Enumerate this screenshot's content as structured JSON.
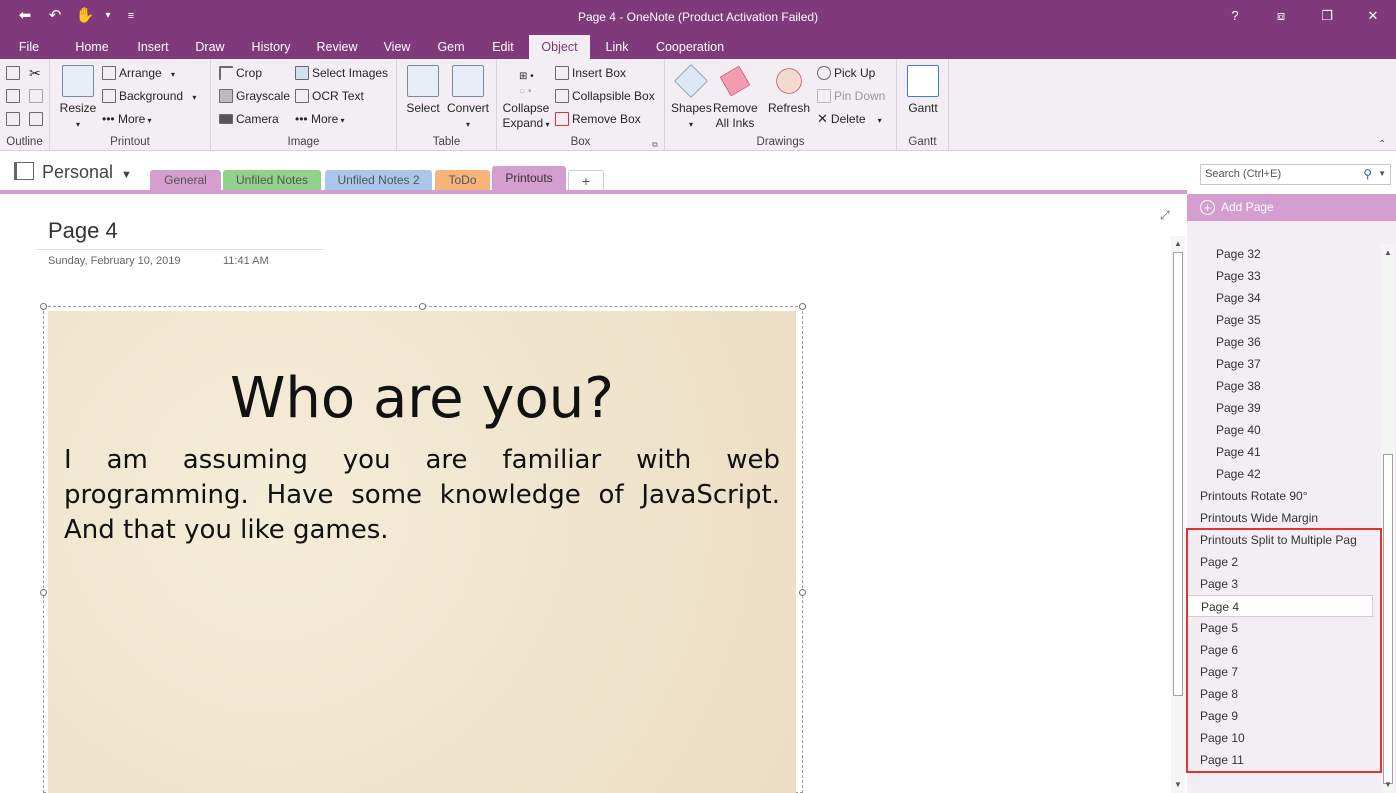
{
  "window": {
    "title": "Page 4 - OneNote (Product Activation Failed)",
    "controls": [
      "?",
      "⧈",
      "❐",
      "✕"
    ]
  },
  "qat": [
    "⬅",
    "↶",
    "✋",
    "▾",
    "≡"
  ],
  "ribbon_tabs": [
    "File",
    "Home",
    "Insert",
    "Draw",
    "History",
    "Review",
    "View",
    "Gem",
    "Edit",
    "Object",
    "Link",
    "Cooperation"
  ],
  "active_tab": "Object",
  "groups": {
    "outline": "Outline",
    "printout": {
      "label": "Printout",
      "resize": "Resize",
      "arrange": "Arrange",
      "background": "Background",
      "more": "More"
    },
    "image": {
      "label": "Image",
      "crop": "Crop",
      "grayscale": "Grayscale",
      "camera": "Camera",
      "select_images": "Select Images",
      "ocr_text": "OCR Text",
      "more": "More"
    },
    "table": {
      "label": "Table",
      "select": "Select",
      "convert": "Convert"
    },
    "box": {
      "label": "Box",
      "collapse": "Collapse",
      "expand": "Expand",
      "insert_box": "Insert Box",
      "collapsible_box": "Collapsible Box",
      "remove_box": "Remove Box"
    },
    "drawings": {
      "label": "Drawings",
      "shapes": "Shapes",
      "remove": "Remove",
      "all_inks": "All Inks",
      "refresh": "Refresh",
      "pick_up": "Pick Up",
      "pin_down": "Pin Down",
      "delete": "Delete"
    },
    "gantt": {
      "label": "Gantt",
      "gantt": "Gantt"
    }
  },
  "notebook": {
    "name": "Personal"
  },
  "sections": [
    {
      "label": "General",
      "color": "#d49ed1"
    },
    {
      "label": "Unfiled Notes",
      "color": "#92d18b"
    },
    {
      "label": "Unfiled Notes 2",
      "color": "#a9c7ea"
    },
    {
      "label": "ToDo",
      "color": "#f5b47a"
    },
    {
      "label": "Printouts",
      "color": "#d49ed1"
    },
    {
      "label": "+",
      "color": "#ffffff"
    }
  ],
  "search": {
    "placeholder": "Search (Ctrl+E)"
  },
  "page": {
    "title": "Page 4",
    "date": "Sunday, February 10, 2019",
    "time": "11:41 AM"
  },
  "slide": {
    "heading": "Who are you?",
    "body": "I am assuming you are familiar with web programming. Have some knowledge of JavaScript. And that you like games."
  },
  "pages_pane": {
    "add_page": "Add Page",
    "items": [
      {
        "label": "Page 32",
        "level": "sub"
      },
      {
        "label": "Page 33",
        "level": "sub"
      },
      {
        "label": "Page 34",
        "level": "sub"
      },
      {
        "label": "Page 35",
        "level": "sub"
      },
      {
        "label": "Page 36",
        "level": "sub"
      },
      {
        "label": "Page 37",
        "level": "sub"
      },
      {
        "label": "Page 38",
        "level": "sub"
      },
      {
        "label": "Page 39",
        "level": "sub"
      },
      {
        "label": "Page 40",
        "level": "sub"
      },
      {
        "label": "Page 41",
        "level": "sub"
      },
      {
        "label": "Page 42",
        "level": "sub"
      },
      {
        "label": "Printouts Rotate 90°",
        "level": "top"
      },
      {
        "label": "Printouts Wide Margin",
        "level": "top"
      },
      {
        "label": "Printouts Split to Multiple Pag",
        "level": "top"
      },
      {
        "label": "Page 2",
        "level": "top"
      },
      {
        "label": "Page 3",
        "level": "top"
      },
      {
        "label": "Page 4",
        "level": "top",
        "selected": true
      },
      {
        "label": "Page 5",
        "level": "top"
      },
      {
        "label": "Page 6",
        "level": "top"
      },
      {
        "label": "Page 7",
        "level": "top"
      },
      {
        "label": "Page 8",
        "level": "top"
      },
      {
        "label": "Page 9",
        "level": "top"
      },
      {
        "label": "Page 10",
        "level": "top"
      },
      {
        "label": "Page 11",
        "level": "top"
      }
    ]
  }
}
